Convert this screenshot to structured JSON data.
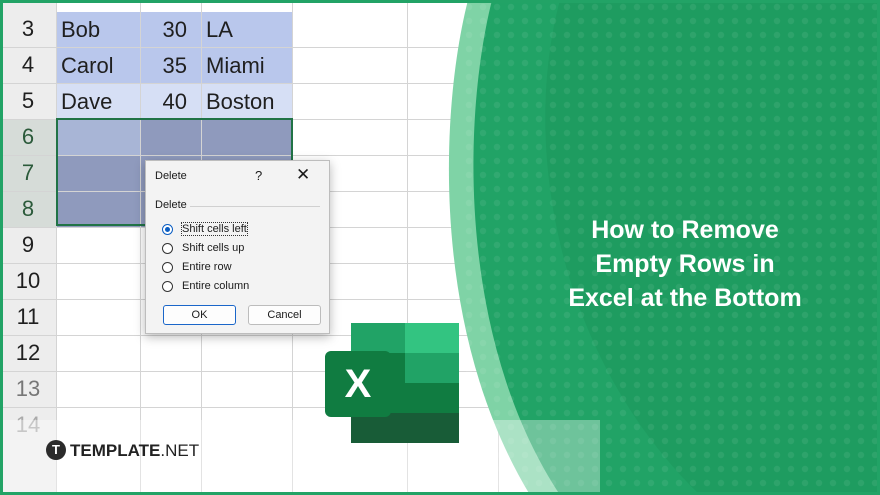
{
  "rows": [
    {
      "num": "3",
      "name": "Bob",
      "age": "30",
      "city": "LA"
    },
    {
      "num": "4",
      "name": "Carol",
      "age": "35",
      "city": "Miami"
    },
    {
      "num": "5",
      "name": "Dave",
      "age": "40",
      "city": "Boston"
    },
    {
      "num": "6",
      "name": "",
      "age": "",
      "city": ""
    },
    {
      "num": "7",
      "name": "",
      "age": "",
      "city": ""
    },
    {
      "num": "8",
      "name": "",
      "age": "",
      "city": ""
    },
    {
      "num": "9",
      "name": "",
      "age": "",
      "city": ""
    },
    {
      "num": "10",
      "name": "",
      "age": "",
      "city": ""
    },
    {
      "num": "11",
      "name": "",
      "age": "",
      "city": ""
    },
    {
      "num": "12",
      "name": "",
      "age": "",
      "city": ""
    },
    {
      "num": "13",
      "name": "",
      "age": "",
      "city": ""
    },
    {
      "num": "14",
      "name": "",
      "age": "",
      "city": ""
    }
  ],
  "dialog": {
    "title": "Delete",
    "help": "?",
    "close": "✕",
    "group_label": "Delete",
    "options": [
      {
        "label": "Shift cells left",
        "selected": true
      },
      {
        "label": "Shift cells up",
        "selected": false
      },
      {
        "label": "Entire row",
        "selected": false
      },
      {
        "label": "Entire column",
        "selected": false
      }
    ],
    "ok_label": "OK",
    "cancel_label": "Cancel"
  },
  "headline": {
    "line1": "How to Remove",
    "line2": "Empty Rows in",
    "line3": "Excel at the Bottom"
  },
  "logo": {
    "letter": "X",
    "icon": "excel-icon"
  },
  "brand": {
    "bold": "TEMPLATE",
    "suffix": ".NET"
  },
  "colors": {
    "accent_green": "#21a366",
    "dark_green": "#107c41",
    "selection_border": "#217346",
    "data_fill": "#b9c7ec",
    "radio_blue": "#0a5dc2"
  }
}
